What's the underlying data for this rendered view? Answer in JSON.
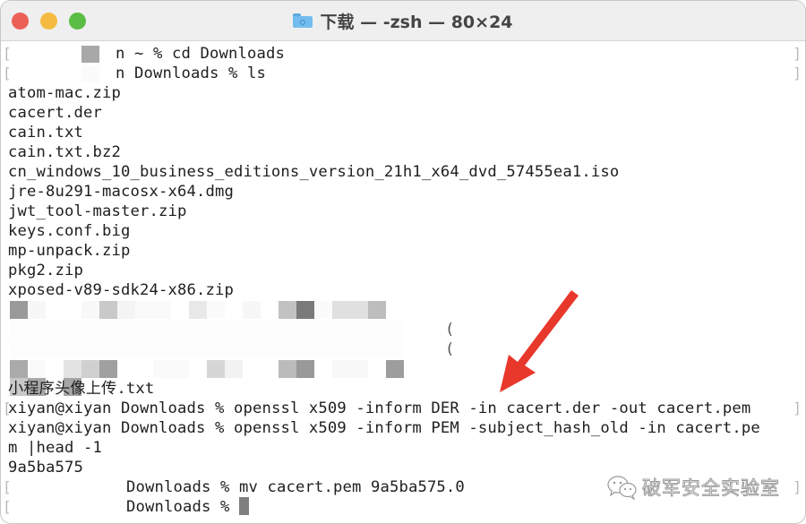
{
  "window": {
    "title": "下载 — -zsh — 80×24",
    "title_icon": "folder-icon",
    "traffic_lights": {
      "close_color": "#ec5f57",
      "minimize_color": "#f4bb40",
      "maximize_color": "#5bbd44"
    }
  },
  "terminal": {
    "lines": [
      {
        "kind": "prompt",
        "prompt_visible": "n ~ %",
        "command": "cd Downloads",
        "redacted_prefix": true
      },
      {
        "kind": "prompt",
        "prompt_visible": "n Downloads %",
        "command": "ls",
        "redacted_prefix": true
      },
      {
        "kind": "output",
        "text": "atom-mac.zip"
      },
      {
        "kind": "output",
        "text": "cacert.der"
      },
      {
        "kind": "output",
        "text": "cain.txt"
      },
      {
        "kind": "output",
        "text": "cain.txt.bz2"
      },
      {
        "kind": "output",
        "text": "cn_windows_10_business_editions_version_21h1_x64_dvd_57455ea1.iso"
      },
      {
        "kind": "output",
        "text": "jre-8u291-macosx-x64.dmg"
      },
      {
        "kind": "output",
        "text": "jwt_tool-master.zip"
      },
      {
        "kind": "output",
        "text": "keys.conf.big"
      },
      {
        "kind": "output",
        "text": "mp-unpack.zip"
      },
      {
        "kind": "output",
        "text": "pkg2.zip"
      },
      {
        "kind": "output",
        "text": "xposed-v89-sdk24-x86.zip"
      },
      {
        "kind": "redacted",
        "text": ""
      },
      {
        "kind": "redacted",
        "text": ""
      },
      {
        "kind": "redacted",
        "text": ""
      },
      {
        "kind": "redacted",
        "text": ""
      },
      {
        "kind": "output",
        "text": "小程序头像上传.txt"
      },
      {
        "kind": "prompt",
        "prompt_visible": "xiyan@xiyan Downloads %",
        "command": "openssl x509 -inform DER -in cacert.der -out cacert.pem"
      },
      {
        "kind": "prompt",
        "prompt_visible": "xiyan@xiyan Downloads %",
        "command": "openssl x509 -inform PEM -subject_hash_old -in cacert.pe"
      },
      {
        "kind": "output",
        "text": "m |head -1"
      },
      {
        "kind": "output",
        "text": "9a5ba575"
      },
      {
        "kind": "prompt",
        "prompt_visible": "Downloads %",
        "command": "mv cacert.pem 9a5ba575.0",
        "redacted_prefix": true
      },
      {
        "kind": "prompt",
        "prompt_visible": "Downloads %",
        "command": "",
        "redacted_prefix": true,
        "cursor": true
      }
    ]
  },
  "annotation": {
    "arrow_color": "#e8372b",
    "arrow_points_to": "openssl x509 -inform DER command"
  },
  "watermark": {
    "icon": "wechat-icon",
    "text": "破军安全实验室"
  }
}
